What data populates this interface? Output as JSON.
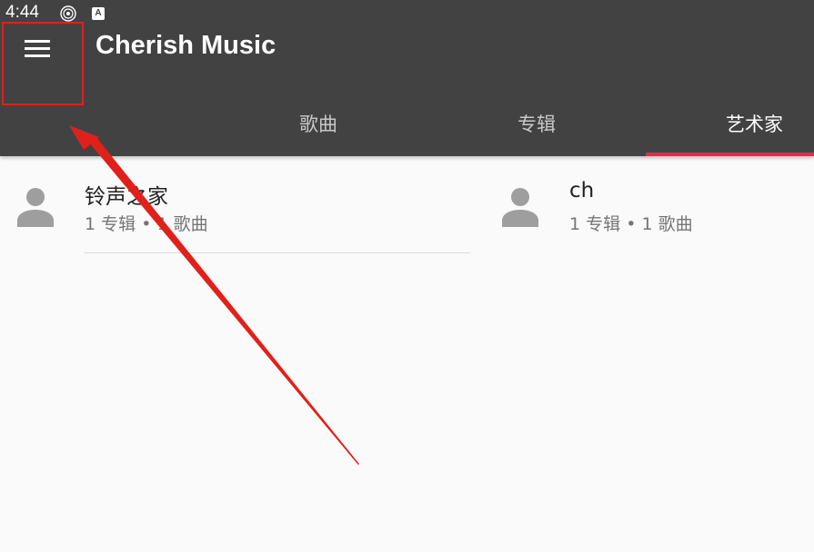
{
  "status_bar": {
    "time": "4:44",
    "icons": [
      "disc-icon",
      "keyboard-a-icon"
    ],
    "a_glyph": "A"
  },
  "app_bar": {
    "title": "Cherish Music",
    "menu_icon": "hamburger-menu-icon",
    "background": "#424242"
  },
  "tabs": [
    {
      "label": "歌曲",
      "active": false
    },
    {
      "label": "专辑",
      "active": false
    },
    {
      "label": "艺术家",
      "active": true
    }
  ],
  "accent_color": "#e8284a",
  "artists": [
    {
      "name": "铃声之家",
      "albums": "1 专辑",
      "songs": "1 歌曲",
      "separator": "•"
    },
    {
      "name": "ch",
      "albums": "1 专辑",
      "songs": "1 歌曲",
      "separator": "•"
    }
  ],
  "annotation": {
    "highlight_color": "#e0211b",
    "type": "arrow pointing to menu button"
  }
}
